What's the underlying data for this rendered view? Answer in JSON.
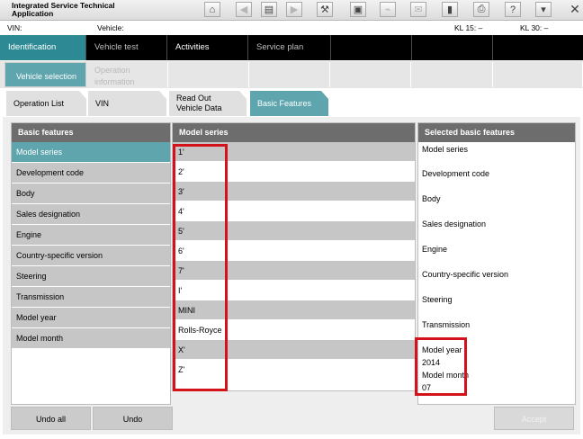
{
  "app": {
    "title": "Integrated Service Technical Application"
  },
  "toolbar": {
    "icons": [
      "home-icon",
      "back-icon",
      "document-icon",
      "forward-icon",
      "wrench-icon",
      "cards-icon",
      "connect-icon",
      "mail-icon",
      "battery-icon",
      "printer-icon",
      "help-icon",
      "dropdown-window-icon",
      "close-icon"
    ],
    "glyphs": [
      "⌂",
      "◀",
      "▤",
      "▶",
      "⚒",
      "▣",
      "⌁",
      "✉",
      "▮",
      "⎙",
      "?",
      "▾",
      "✕"
    ]
  },
  "infobar": {
    "vin_label": "VIN:",
    "vehicle_label": "Vehicle:",
    "kl15": "KL 15:  –",
    "kl30": "KL 30:  –"
  },
  "nav": {
    "items": [
      {
        "label": "Identification"
      },
      {
        "label": "Vehicle test"
      },
      {
        "label": "Activities"
      },
      {
        "label": "Service plan"
      }
    ]
  },
  "subnav": {
    "vehicle_selection": "Vehicle selection",
    "operation_information": "Operation information"
  },
  "tabs": [
    {
      "label": "Operation List"
    },
    {
      "label": "VIN"
    },
    {
      "label": "Read Out Vehicle Data"
    },
    {
      "label": "Basic Features"
    }
  ],
  "basic_features": {
    "header": "Basic features",
    "items": [
      "Model series",
      "Development code",
      "Body",
      "Sales designation",
      "Engine",
      "Country-specific version",
      "Steering",
      "Transmission",
      "Model year",
      "Model month"
    ],
    "selected_index": 0
  },
  "model_series": {
    "header": "Model series",
    "items": [
      "1'",
      "2'",
      "3'",
      "4'",
      "5'",
      "6'",
      "7'",
      "I'",
      "MINI",
      "Rolls-Royce",
      "X'",
      "Z'"
    ]
  },
  "selected_features": {
    "header": "Selected basic features",
    "items": [
      "Model series",
      "Development code",
      "Body",
      "Sales designation",
      "Engine",
      "Country-specific version",
      "Steering",
      "Transmission",
      "Model year",
      "2014",
      "Model month",
      "07"
    ]
  },
  "buttons": {
    "undo_all": "Undo all",
    "undo": "Undo",
    "accept": "Accept"
  },
  "colors": {
    "accent": "#5ea5ad",
    "nav_active": "#2d8a94",
    "highlight": "#d4121b"
  }
}
